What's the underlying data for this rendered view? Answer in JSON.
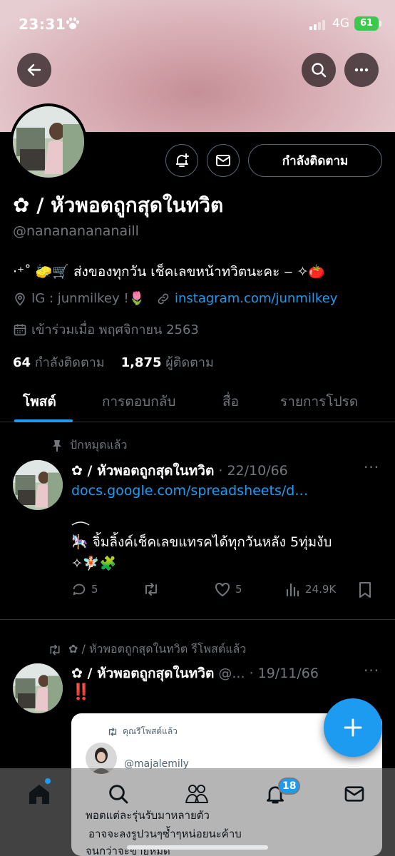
{
  "status_bar": {
    "time": "23:31",
    "network": "4G",
    "battery": "61"
  },
  "profile": {
    "display_name": "✿ / หัวพอตถูกสุดในทวิต",
    "handle": "@nanananananaill",
    "bio": "·⁺˚ 🧽🛒 ส่งของทุกวัน เช็คเลขหน้าทวิตนะคะ ‒ ✧🍅",
    "ig_prefix": "IG : junmilkey  !🌷",
    "website": "instagram.com/junmilkey",
    "joined": "เข้าร่วมเมื่อ พฤศจิกายน 2563",
    "following_count": "64",
    "following_label": "กำลังติดตาม",
    "followers_count": "1,875",
    "followers_label": "ผู้ติดตาม",
    "follow_button": "กำลังติดตาม"
  },
  "tabs": [
    "โพสต์",
    "การตอบกลับ",
    "สื่อ",
    "รายการโปรด"
  ],
  "pinned_tweet": {
    "pinned_label": "ปักหมุดแล้ว",
    "name": "✿ / หัวพอตถูกสุดในทวิต",
    "date": "· 22/10/66",
    "link": "docs.google.com/spreadsheets/d…",
    "text_line1": "🎠 จิ้มลิ้งค์เช็คเลขแทรคได้ทุกวันหลัง 5ทุ่มงับ",
    "text_line2": "✧🧚🏻🧩",
    "replies": "5",
    "likes": "5",
    "views": "24.9K"
  },
  "repost_tweet": {
    "repost_label": "✿ / หัวพอตถูกสุดในทวิต รีโพสต์แล้ว",
    "name": "✿ / หัวพอตถูกสุดในทวิต",
    "handle_trunc": "@...",
    "date": "· 19/11/66",
    "text": "‼️"
  },
  "embedded_card": {
    "repost_label": "คุณรีโพสต์แล้ว",
    "handle": "@majalemily",
    "line1": "พอตแต่ละรุ่นรับมาหลายตัว",
    "line2": "อาจจะลงรูปวนๆซ้ำๆหน่อยนะค้าบ",
    "line3": "จนกว่าจะขายหมด"
  },
  "bottom_nav": {
    "notifications_badge": "18"
  },
  "colors": {
    "accent": "#1d9bf0",
    "background": "#000000",
    "muted": "#71767b",
    "divider": "#2f3336"
  }
}
